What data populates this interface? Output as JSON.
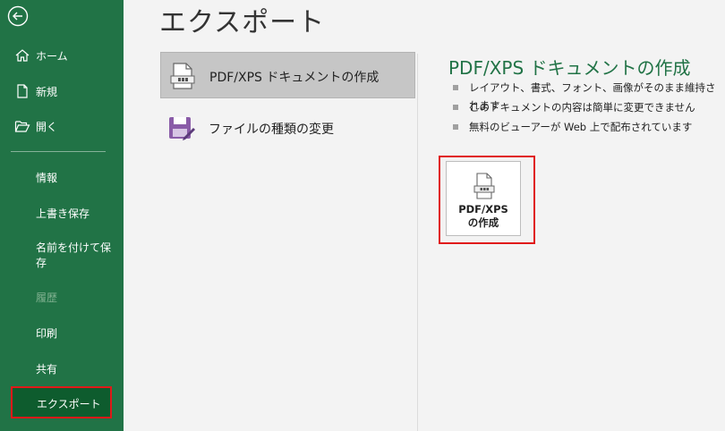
{
  "sidebar": {
    "items": [
      {
        "label": "ホーム",
        "icon": "home-icon"
      },
      {
        "label": "新規",
        "icon": "new-document-icon"
      },
      {
        "label": "開く",
        "icon": "open-folder-icon"
      },
      {
        "label": "情報"
      },
      {
        "label": "上書き保存"
      },
      {
        "label": "名前を付けて保存"
      },
      {
        "label": "履歴"
      },
      {
        "label": "印刷"
      },
      {
        "label": "共有"
      },
      {
        "label": "エクスポート"
      }
    ],
    "active_item": "エクスポート",
    "disabled_item": "履歴"
  },
  "main": {
    "title": "エクスポート",
    "options": [
      {
        "label": "PDF/XPS ドキュメントの作成",
        "icon": "pdf-document-icon",
        "selected": true
      },
      {
        "label": "ファイルの種類の変更",
        "icon": "change-file-type-icon",
        "selected": false
      }
    ]
  },
  "detail": {
    "title": "PDF/XPS ドキュメントの作成",
    "bullets": [
      "レイアウト、書式、フォント、画像がそのまま維持されます",
      "このドキュメントの内容は簡単に変更できません",
      "無料のビューアーが Web 上で配布されています"
    ],
    "create_button": {
      "line1": "PDF/XPS",
      "line2": "の作成"
    }
  },
  "colors": {
    "sidebar": "#217346",
    "active_item": "#0e5c2e",
    "highlight_border": "#e01919",
    "detail_title": "#217346"
  }
}
